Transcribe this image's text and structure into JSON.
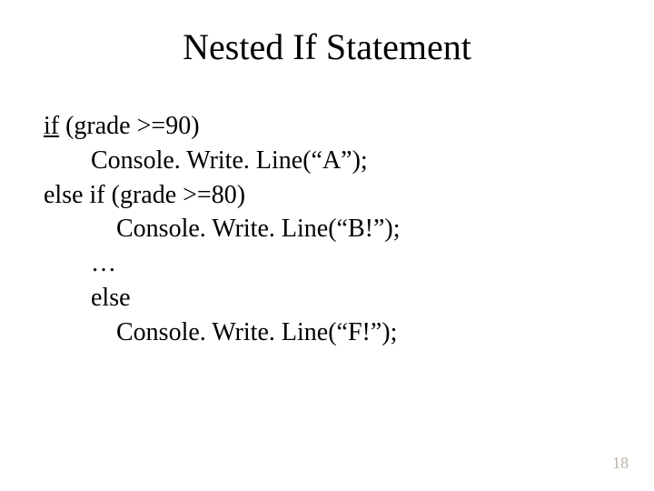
{
  "title": "Nested If Statement",
  "code": {
    "l1_if": "if",
    "l1_rest": " (grade >=90)",
    "l2": "Console. Write. Line(“A”);",
    "l3": "else if (grade >=80)",
    "l4": "Console. Write. Line(“B!”);",
    "l5": "…",
    "l6": "else",
    "l7": "Console. Write. Line(“F!”);"
  },
  "page_number": "18"
}
